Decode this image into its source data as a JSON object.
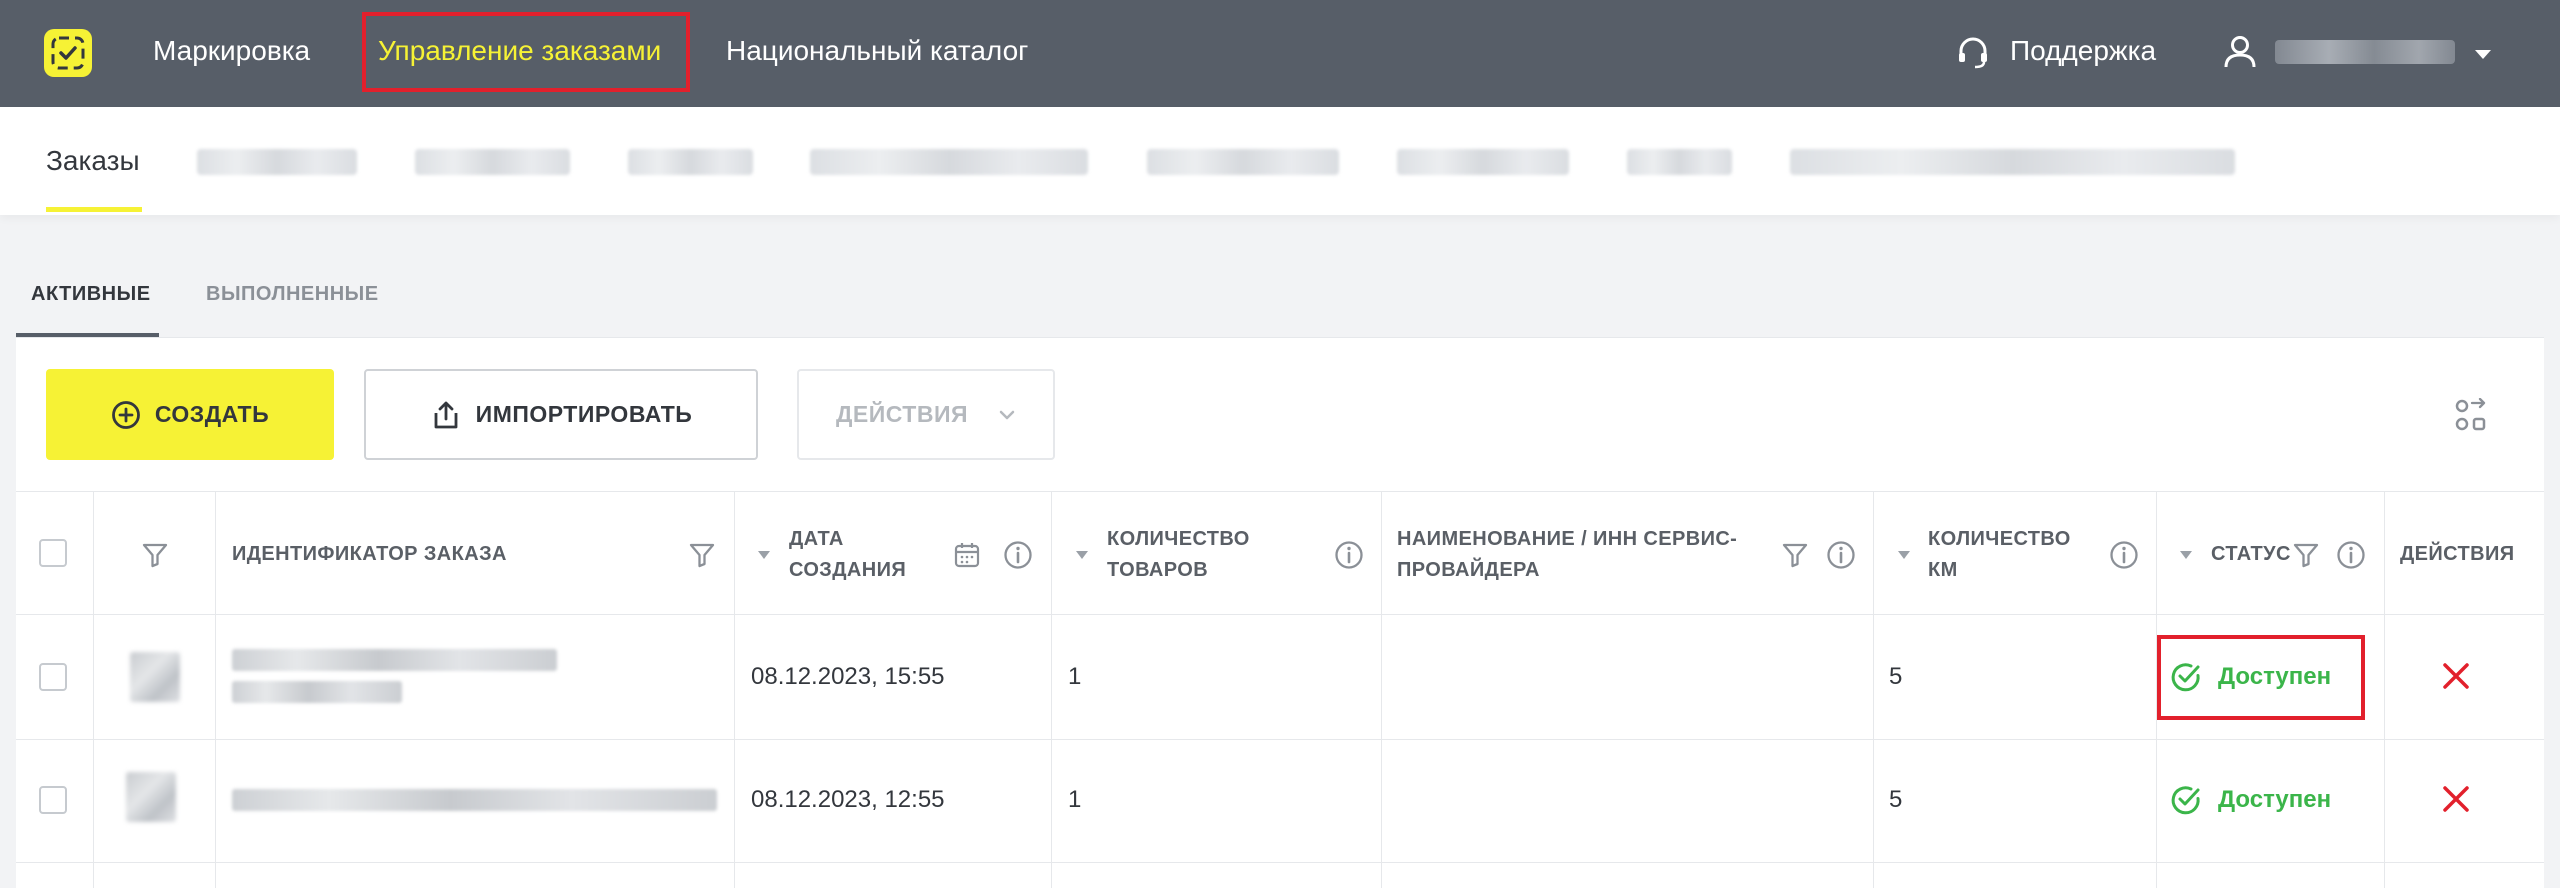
{
  "header": {
    "nav": [
      {
        "label": "Маркировка",
        "active": false
      },
      {
        "label": "Управление заказами",
        "active": true
      },
      {
        "label": "Национальный каталог",
        "active": false
      }
    ],
    "support_label": "Поддержка",
    "accent_color": "#f6f235",
    "highlight_color": "#e2202c"
  },
  "subnav": {
    "first_tab": "Заказы"
  },
  "tabs": {
    "active": "АКТИВНЫЕ",
    "done": "ВЫПОЛНЕННЫЕ"
  },
  "toolbar": {
    "create_label": "СОЗДАТЬ",
    "import_label": "ИМПОРТИРОВАТЬ",
    "actions_label": "ДЕЙСТВИЯ"
  },
  "table": {
    "headers": {
      "order_id": "ИДЕНТИФИКАТОР ЗАКАЗА",
      "created_line1": "ДАТА",
      "created_line2": "СОЗДАНИЯ",
      "qty_line1": "КОЛИЧЕСТВО",
      "qty_line2": "ТОВАРОВ",
      "provider_line1": "НАИМЕНОВАНИЕ / ИНН СЕРВИС-",
      "provider_line2": "ПРОВАЙДЕРА",
      "km_line1": "КОЛИЧЕСТВО",
      "km_line2": "КМ",
      "status": "СТАТУС",
      "actions": "ДЕЙСТВИЯ"
    },
    "rows": [
      {
        "created": "08.12.2023, 15:55",
        "qty": "1",
        "provider": "",
        "km": "5",
        "status": "Доступен"
      },
      {
        "created": "08.12.2023, 12:55",
        "qty": "1",
        "provider": "",
        "km": "5",
        "status": "Доступен"
      }
    ],
    "status_color": "#3bb54a",
    "delete_color": "#e2202c"
  }
}
